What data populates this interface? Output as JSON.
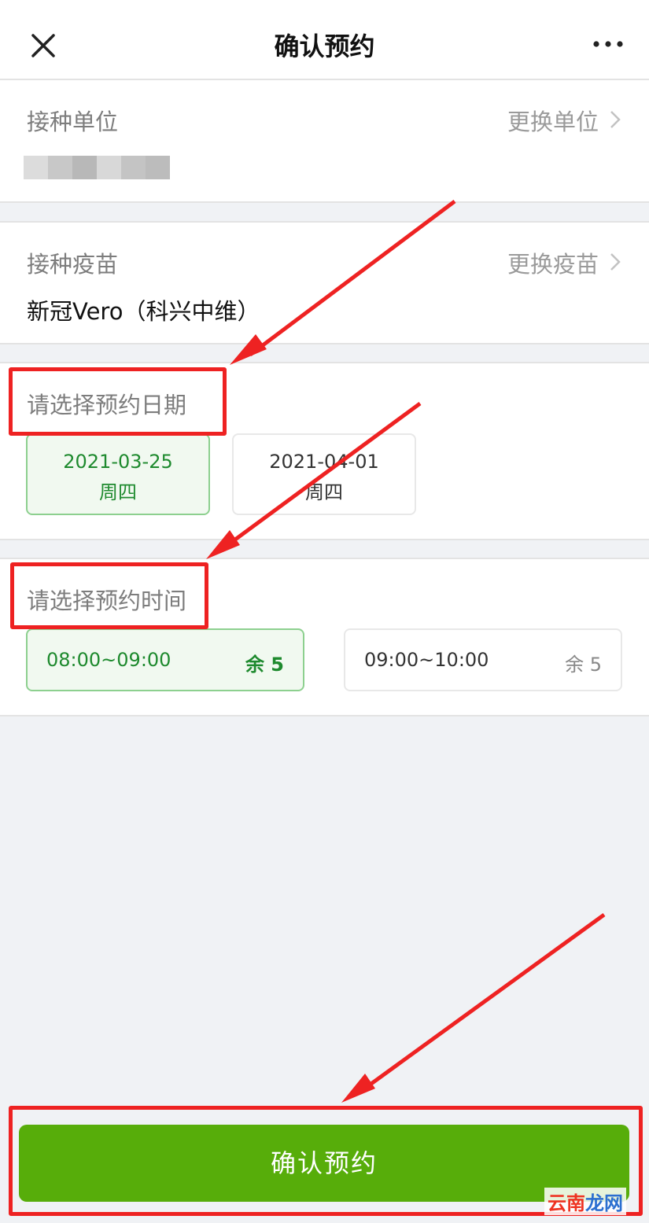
{
  "header": {
    "title": "确认预约",
    "close_icon": "close-icon",
    "more_icon": "more-icon"
  },
  "unit_section": {
    "label": "接种单位",
    "action": "更换单位",
    "value_blurred": true
  },
  "vaccine_section": {
    "label": "接种疫苗",
    "action": "更换疫苗",
    "value": "新冠Vero（科兴中维）"
  },
  "date_section": {
    "label": "请选择预约日期",
    "options": [
      {
        "date": "2021-03-25",
        "weekday": "周四",
        "selected": true
      },
      {
        "date": "2021-04-01",
        "weekday": "周四",
        "selected": false
      }
    ]
  },
  "time_section": {
    "label": "请选择预约时间",
    "options": [
      {
        "range": "08:00~09:00",
        "remaining": "余 5",
        "selected": true
      },
      {
        "range": "09:00~10:00",
        "remaining": "余 5",
        "selected": false
      }
    ]
  },
  "footer": {
    "confirm_label": "确认预约"
  },
  "watermark": {
    "part1": "云南",
    "part2": "龙网"
  },
  "colors": {
    "accent_green": "#57ad0a",
    "selected_text": "#1e8a2e",
    "annotation_red": "#ee2222"
  }
}
